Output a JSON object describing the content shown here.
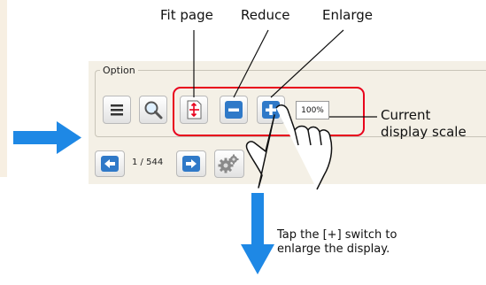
{
  "labels": {
    "fit_page": "Fit page",
    "reduce": "Reduce",
    "enlarge": "Enlarge",
    "current_scale_line1": "Current",
    "current_scale_line2": "display scale"
  },
  "option_panel": {
    "title": "Option",
    "zoom_value": "100%",
    "page_indicator": "1 / 544"
  },
  "icons": [
    "menu-icon",
    "magnifier-icon",
    "fit-page-icon",
    "minus-icon",
    "plus-icon",
    "arrow-left-icon",
    "arrow-right-icon",
    "gear-icon",
    "hand-pointer-icon"
  ],
  "note": {
    "line1": "Tap the [+] switch to",
    "line2": "enlarge the display."
  },
  "colors": {
    "highlight": "#e8001c",
    "arrow": "#1e88e5",
    "blue_button": "#2f79c8"
  }
}
